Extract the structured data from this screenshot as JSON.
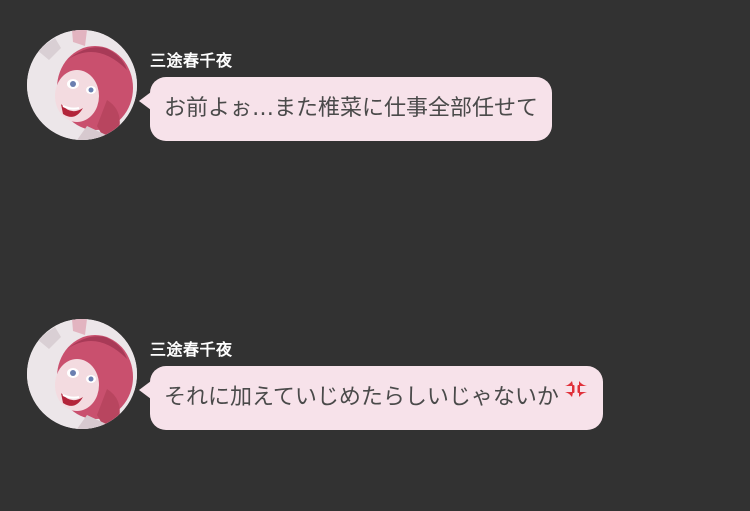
{
  "chat": {
    "messages": [
      {
        "sender": "三途春千夜",
        "text": "お前よぉ…また椎菜に仕事全部任せて",
        "avatar_icon": "character-avatar",
        "emoji": null
      },
      {
        "sender": "三途春千夜",
        "text": "それに加えていじめたらしいじゃないか",
        "avatar_icon": "character-avatar",
        "emoji": "anger-symbol-icon"
      }
    ]
  },
  "colors": {
    "background": "#323232",
    "bubble": "#f7e2ea",
    "bubble_text": "#4a4a4a",
    "sender_text": "#ffffff",
    "hair": "#c9506e",
    "anger": "#e0303a"
  }
}
